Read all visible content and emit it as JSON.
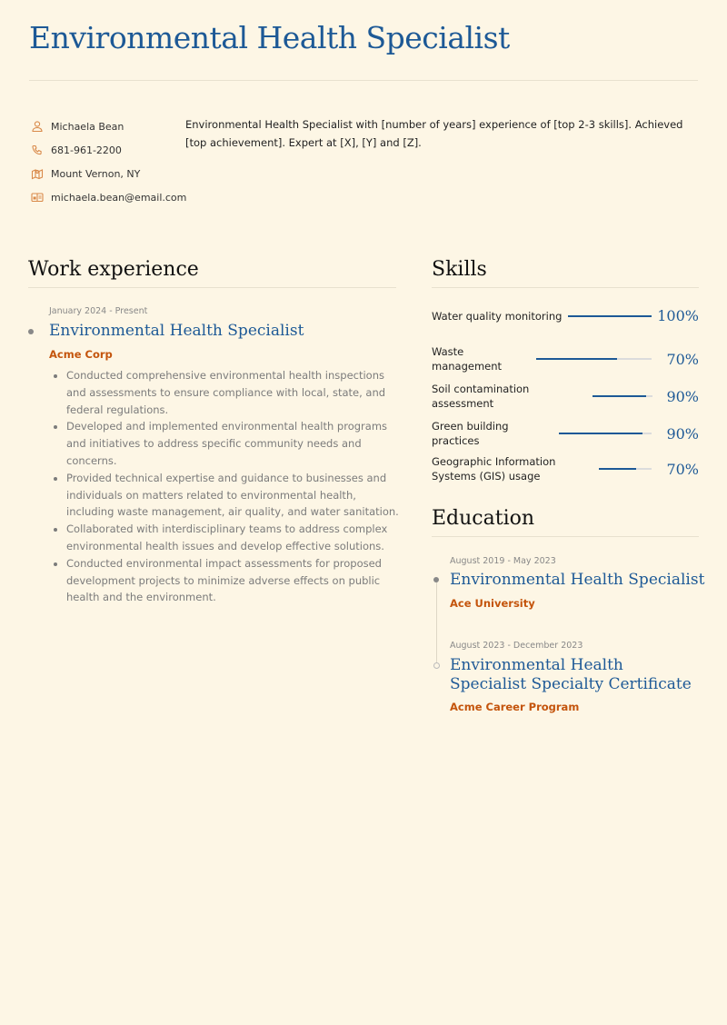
{
  "header": {
    "title": "Environmental Health Specialist"
  },
  "contact": {
    "name": "Michaela Bean",
    "phone": "681-961-2200",
    "location": "Mount Vernon, NY",
    "email": "michaela.bean@email.com",
    "icons": [
      "person-icon",
      "phone-icon",
      "map-icon",
      "id-card-icon"
    ],
    "icon_color": "#d98a4a"
  },
  "summary": "Environmental Health Specialist with [number of years] experience of [top 2-3 skills]. Achieved [top achievement]. Expert at [X], [Y] and [Z].",
  "work": {
    "heading": "Work experience",
    "jobs": [
      {
        "dates": "January 2024 - Present",
        "title": "Environmental Health Specialist",
        "company": "Acme Corp",
        "bullets": [
          "Conducted comprehensive environmental health inspections and assessments to ensure compliance with local, state, and federal regulations.",
          "Developed and implemented environmental health programs and initiatives to address specific community needs and concerns.",
          "Provided technical expertise and guidance to businesses and individuals on matters related to environmental health, including waste management, air quality, and water sanitation.",
          "Collaborated with interdisciplinary teams to address complex environmental health issues and develop effective solutions.",
          "Conducted environmental impact assessments for proposed development projects to minimize adverse effects on public health and the environment."
        ]
      }
    ]
  },
  "skills": {
    "heading": "Skills",
    "items": [
      {
        "name": "Water quality monitoring",
        "percent": 100,
        "label": "100%"
      },
      {
        "name": "Waste management",
        "percent": 70,
        "label": "70%"
      },
      {
        "name": "Soil contamination assessment",
        "percent": 90,
        "label": "90%"
      },
      {
        "name": "Green building practices",
        "percent": 90,
        "label": "90%"
      },
      {
        "name": "Geographic Information Systems (GIS) usage",
        "percent": 70,
        "label": "70%"
      }
    ]
  },
  "education": {
    "heading": "Education",
    "items": [
      {
        "dates": "August 2019 - May 2023",
        "title": "Environmental Health Specialist",
        "school": "Ace University"
      },
      {
        "dates": "August 2023 - December 2023",
        "title": "Environmental Health Specialist Specialty Certificate",
        "school": "Acme Career Program"
      }
    ]
  },
  "colors": {
    "accent": "#1d5996",
    "org": "#c4540c",
    "background": "#fdf6e5"
  }
}
